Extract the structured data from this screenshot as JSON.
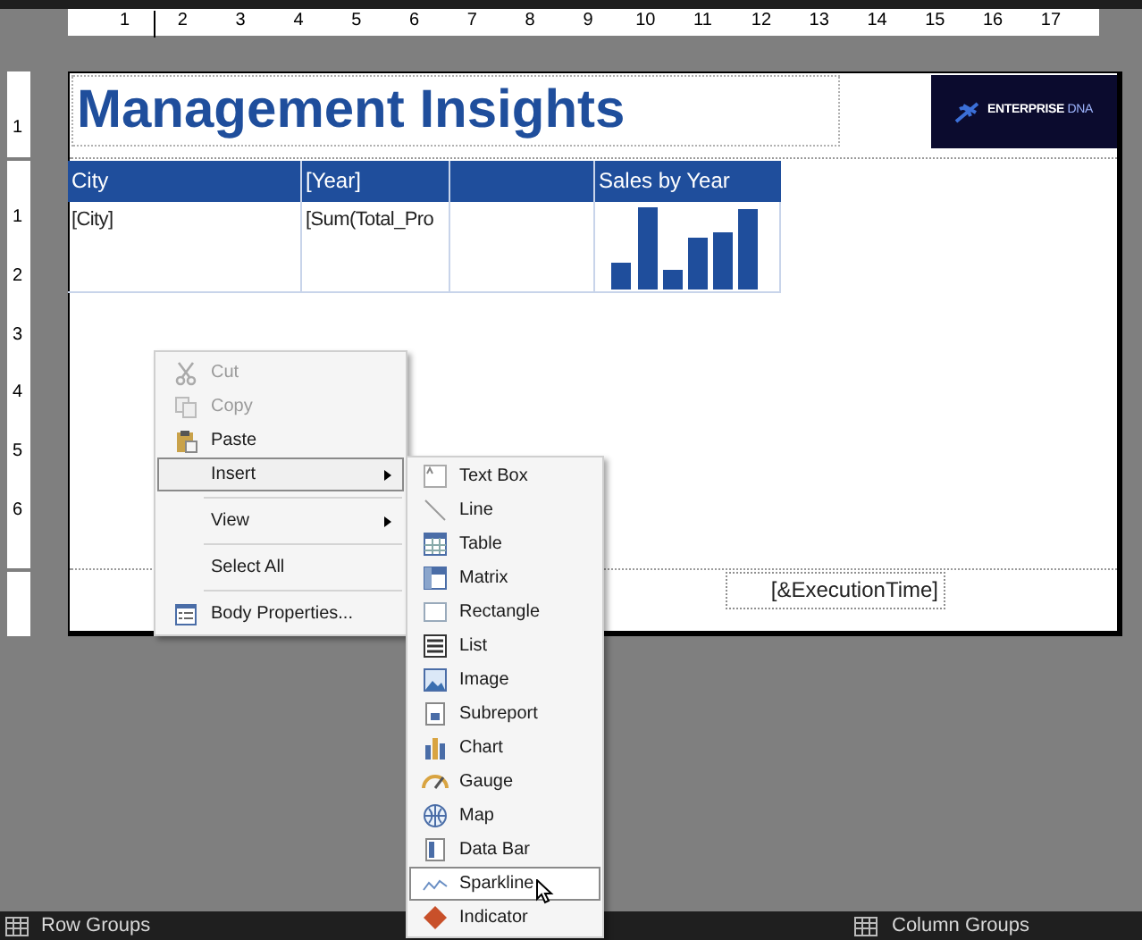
{
  "ruler": {
    "horizontal_labels": [
      "1",
      "2",
      "3",
      "4",
      "5",
      "6",
      "7",
      "8",
      "9",
      "10",
      "11",
      "12",
      "13",
      "14",
      "15",
      "16",
      "17"
    ],
    "header_labels": [
      "1"
    ],
    "body_labels": [
      "1",
      "2",
      "3",
      "4",
      "5",
      "6"
    ]
  },
  "report": {
    "title": "Management Insights",
    "logo": {
      "word_1": "ENTERPRISE",
      "word_2": "DNA"
    },
    "table": {
      "columns": [
        {
          "kind": "text",
          "header": "City",
          "cell": "[City]"
        },
        {
          "kind": "text",
          "header": "[Year]",
          "cell": "[Sum(Total_Pro"
        },
        {
          "kind": "empty"
        },
        {
          "kind": "sparkline",
          "header": "Sales by Year"
        }
      ]
    },
    "footer_text": "[&ExecutionTime]"
  },
  "context_menu": {
    "items": [
      {
        "kind": "item",
        "label": "Cut",
        "disabled": true,
        "selected": false,
        "submenu": false
      },
      {
        "kind": "item",
        "label": "Copy",
        "disabled": true,
        "selected": false,
        "submenu": false
      },
      {
        "kind": "item",
        "label": "Paste",
        "disabled": false,
        "selected": false,
        "submenu": false
      },
      {
        "kind": "item",
        "label": "Insert",
        "disabled": false,
        "selected": true,
        "submenu": true
      },
      {
        "kind": "separator"
      },
      {
        "kind": "item",
        "label": "View",
        "disabled": false,
        "selected": false,
        "submenu": true
      },
      {
        "kind": "separator"
      },
      {
        "kind": "item",
        "label": "Select All",
        "disabled": false,
        "selected": false,
        "submenu": false
      },
      {
        "kind": "separator"
      },
      {
        "kind": "item",
        "label": "Body Properties...",
        "disabled": false,
        "selected": false,
        "submenu": false
      }
    ]
  },
  "insert_submenu": {
    "items": [
      {
        "label": "Text Box",
        "selected": false
      },
      {
        "label": "Line",
        "selected": false
      },
      {
        "label": "Table",
        "selected": false
      },
      {
        "label": "Matrix",
        "selected": false
      },
      {
        "label": "Rectangle",
        "selected": false
      },
      {
        "label": "List",
        "selected": false
      },
      {
        "label": "Image",
        "selected": false
      },
      {
        "label": "Subreport",
        "selected": false
      },
      {
        "label": "Chart",
        "selected": false
      },
      {
        "label": "Gauge",
        "selected": false
      },
      {
        "label": "Map",
        "selected": false
      },
      {
        "label": "Data Bar",
        "selected": false
      },
      {
        "label": "Sparkline",
        "selected": true
      },
      {
        "label": "Indicator",
        "selected": false
      }
    ]
  },
  "status_bar": {
    "row_groups": "Row Groups",
    "column_groups": "Column Groups"
  }
}
